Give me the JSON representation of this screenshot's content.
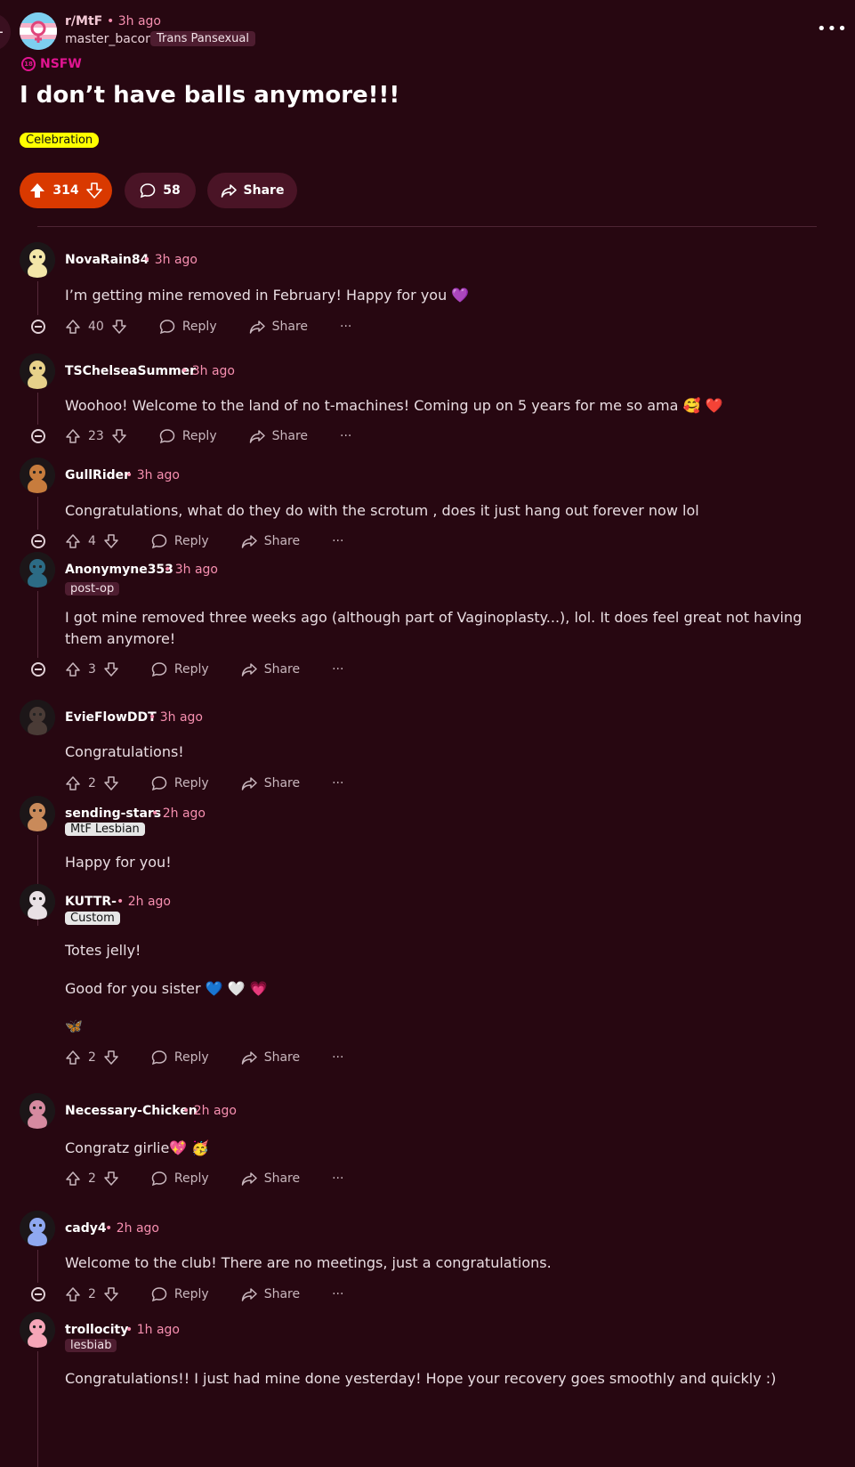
{
  "post": {
    "back_arrow": "←",
    "subreddit": "r/MtF",
    "time": "• 3h ago",
    "author": "master_bacon",
    "author_flair": "Trans Pansexual",
    "more": "•••",
    "nsfw_badge": "18",
    "nsfw": "NSFW",
    "title": "I don’t have balls anymore!!!",
    "flair": "Celebration",
    "score": "314",
    "comment_count": "58",
    "share": "Share"
  },
  "labels": {
    "reply": "Reply",
    "share": "Share",
    "more": "···"
  },
  "comments": [
    {
      "user": "NovaRain84",
      "time": "• 3h ago",
      "flair": "",
      "body": [
        "I’m getting mine removed in February! Happy for you 💜"
      ],
      "score": "40",
      "avatar_color": "#f3e6a8"
    },
    {
      "user": "TSChelseaSummer",
      "time": "• 3h ago",
      "flair": "",
      "body": [
        "Woohoo! Welcome to the land of no t-machines! Coming up on 5 years for me so ama 🥰 ❤️"
      ],
      "score": "23",
      "avatar_color": "#e7d18a"
    },
    {
      "user": "GullRider",
      "time": "• 3h ago",
      "flair": "",
      "body": [
        "Congratulations, what do they do with the scrotum , does it just hang out forever now lol"
      ],
      "score": "4",
      "avatar_color": "#c77c3d"
    },
    {
      "user": "Anonymyne353",
      "time": "• 3h ago",
      "flair": "post-op",
      "body": [
        "I got mine removed three weeks ago (although part of Vaginoplasty...), lol. It does feel great not having them anymore!"
      ],
      "score": "3",
      "avatar_color": "#2c6b85"
    },
    {
      "user": "EvieFlowDDT",
      "time": "• 3h ago",
      "flair": "",
      "body": [
        "Congratulations!"
      ],
      "score": "2",
      "avatar_color": "#4a3b36"
    },
    {
      "user": "sending-stars",
      "time": "• 2h ago",
      "flair": "MtF Lesbian",
      "body": [
        "Happy for you!"
      ],
      "score": "",
      "avatar_color": "#c98a5a"
    },
    {
      "user": "KUTTR-",
      "time": "• 2h ago",
      "flair": "Custom",
      "body": [
        "Totes jelly!",
        "Good for you sister 💙 🤍 💗",
        "🦋"
      ],
      "score": "2",
      "avatar_color": "#e8e0e4"
    },
    {
      "user": "Necessary-Chicken",
      "time": "• 2h ago",
      "flair": "",
      "body": [
        "Congratz girlie💖 🥳"
      ],
      "score": "2",
      "avatar_color": "#d68aa0"
    },
    {
      "user": "cady4",
      "time": "• 2h ago",
      "flair": "",
      "body": [
        "Welcome to the club! There are no meetings, just a congratulations."
      ],
      "score": "2",
      "avatar_color": "#8fa8f0"
    },
    {
      "user": "trollocity",
      "time": "• 1h ago",
      "flair": "lesbiab",
      "body": [
        "Congratulations!! I just had mine done yesterday! Hope your recovery goes smoothly and quickly :)"
      ],
      "score": "",
      "avatar_color": "#f6a6b8"
    }
  ]
}
